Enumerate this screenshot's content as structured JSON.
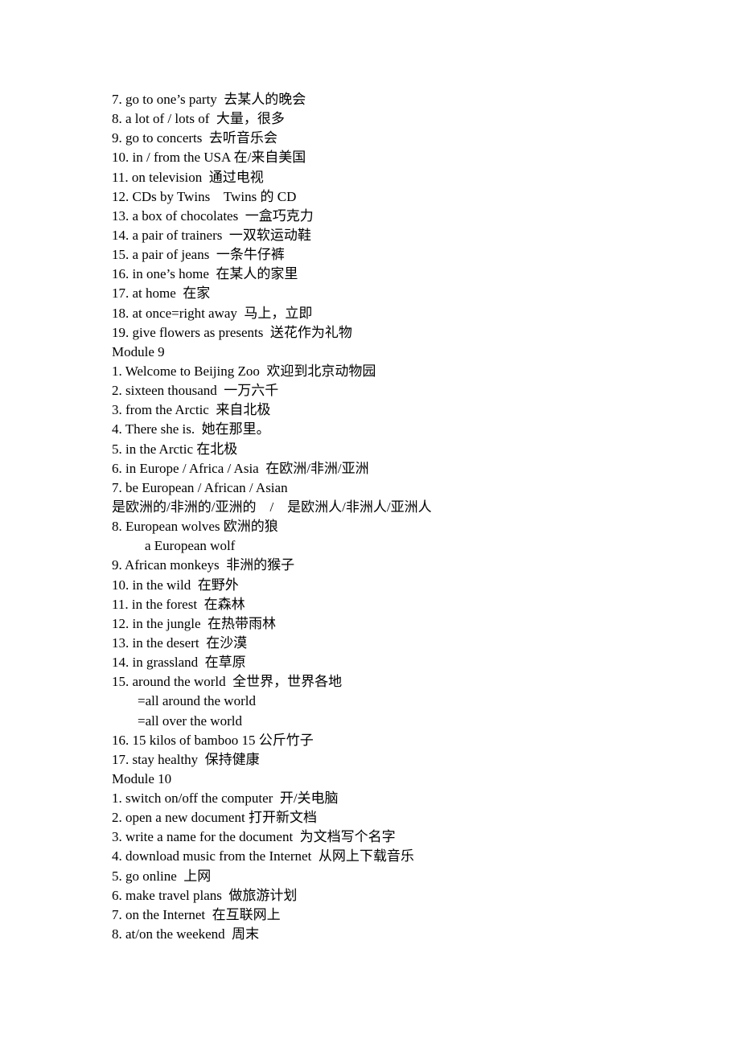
{
  "document": {
    "lines": [
      {
        "text": "7. go to one’s party  去某人的晚会",
        "kind": "item"
      },
      {
        "text": "8. a lot of / lots of  大量，很多",
        "kind": "item"
      },
      {
        "text": "9. go to concerts  去听音乐会",
        "kind": "item"
      },
      {
        "text": "10. in / from the USA 在/来自美国",
        "kind": "item"
      },
      {
        "text": "11. on television  通过电视",
        "kind": "item"
      },
      {
        "text": "12. CDs by Twins    Twins 的 CD",
        "kind": "item"
      },
      {
        "text": "13. a box of chocolates  一盒巧克力",
        "kind": "item"
      },
      {
        "text": "14. a pair of trainers  一双软运动鞋",
        "kind": "item"
      },
      {
        "text": "15. a pair of jeans  一条牛仔裤",
        "kind": "item"
      },
      {
        "text": "16. in one’s home  在某人的家里",
        "kind": "item"
      },
      {
        "text": "17. at home  在家",
        "kind": "item"
      },
      {
        "text": "18. at once=right away  马上，立即",
        "kind": "item"
      },
      {
        "text": "19. give flowers as presents  送花作为礼物",
        "kind": "item"
      },
      {
        "text": "Module 9",
        "kind": "heading"
      },
      {
        "text": "1. Welcome to Beijing Zoo  欢迎到北京动物园",
        "kind": "item"
      },
      {
        "text": "2. sixteen thousand  一万六千",
        "kind": "item"
      },
      {
        "text": "3. from the Arctic  来自北极",
        "kind": "item"
      },
      {
        "text": "4. There she is.  她在那里。",
        "kind": "item"
      },
      {
        "text": "5. in the Arctic 在北极",
        "kind": "item"
      },
      {
        "text": "6. in Europe / Africa / Asia  在欧洲/非洲/亚洲",
        "kind": "item"
      },
      {
        "text": "7. be European / African / Asian",
        "kind": "item"
      },
      {
        "text": "是欧洲的/非洲的/亚洲的    /    是欧洲人/非洲人/亚洲人",
        "kind": "continuation"
      },
      {
        "text": "8. European wolves 欧洲的狼",
        "kind": "item"
      },
      {
        "text": "a European wolf",
        "kind": "indent-1"
      },
      {
        "text": "9. African monkeys  非洲的猴子",
        "kind": "item"
      },
      {
        "text": "10. in the wild  在野外",
        "kind": "item"
      },
      {
        "text": "11. in the forest  在森林",
        "kind": "item"
      },
      {
        "text": "12. in the jungle  在热带雨林",
        "kind": "item"
      },
      {
        "text": "13. in the desert  在沙漠",
        "kind": "item"
      },
      {
        "text": "14. in grassland  在草原",
        "kind": "item"
      },
      {
        "text": "15. around the world  全世界，世界各地",
        "kind": "item"
      },
      {
        "text": "=all around the world",
        "kind": "indent-2"
      },
      {
        "text": "=all over the world",
        "kind": "indent-2"
      },
      {
        "text": "16. 15 kilos of bamboo 15 公斤竹子",
        "kind": "item"
      },
      {
        "text": "17. stay healthy  保持健康",
        "kind": "item"
      },
      {
        "text": "Module 10",
        "kind": "heading"
      },
      {
        "text": "1. switch on/off the computer  开/关电脑",
        "kind": "item"
      },
      {
        "text": "2. open a new document 打开新文档",
        "kind": "item"
      },
      {
        "text": "3. write a name for the document  为文档写个名字",
        "kind": "item"
      },
      {
        "text": "4. download music from the Internet  从网上下载音乐",
        "kind": "item"
      },
      {
        "text": "5. go online  上网",
        "kind": "item"
      },
      {
        "text": "6. make travel plans  做旅游计划",
        "kind": "item"
      },
      {
        "text": "7. on the Internet  在互联网上",
        "kind": "item"
      },
      {
        "text": "8. at/on the weekend  周末",
        "kind": "item"
      }
    ]
  }
}
